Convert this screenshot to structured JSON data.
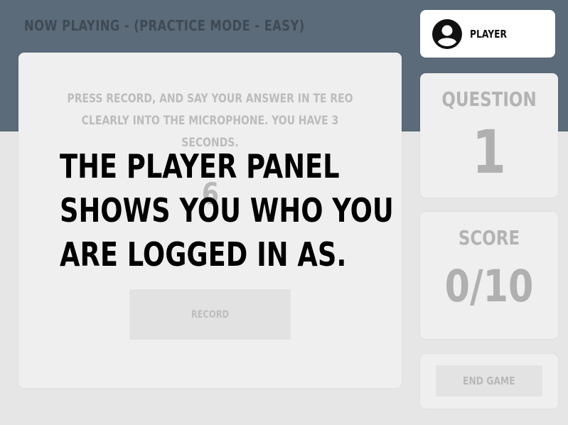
{
  "header": {
    "now_playing": "NOW PLAYING - (PRACTICE MODE - EASY)"
  },
  "main": {
    "instructions": "PRESS RECORD, AND SAY YOUR ANSWER IN TE REO CLEARLY INTO THE MICROPHONE. YOU HAVE 3 SECONDS.",
    "countdown": "6",
    "record_label": "RECORD"
  },
  "player": {
    "label": "PLAYER",
    "icon": "account-circle-icon"
  },
  "question": {
    "title": "QUESTION",
    "value": "1"
  },
  "score": {
    "title": "SCORE",
    "value": "0/10"
  },
  "end_game": {
    "label": "END GAME"
  },
  "tutorial": {
    "text": "THE PLAYER PANEL SHOWS YOU WHO YOU ARE LOGGED IN AS."
  },
  "colors": {
    "header_band": "#5b6b7a",
    "background": "#e6e6e6",
    "card": "#efefef",
    "highlight_card": "#ffffff",
    "tutorial_text": "#000000"
  }
}
